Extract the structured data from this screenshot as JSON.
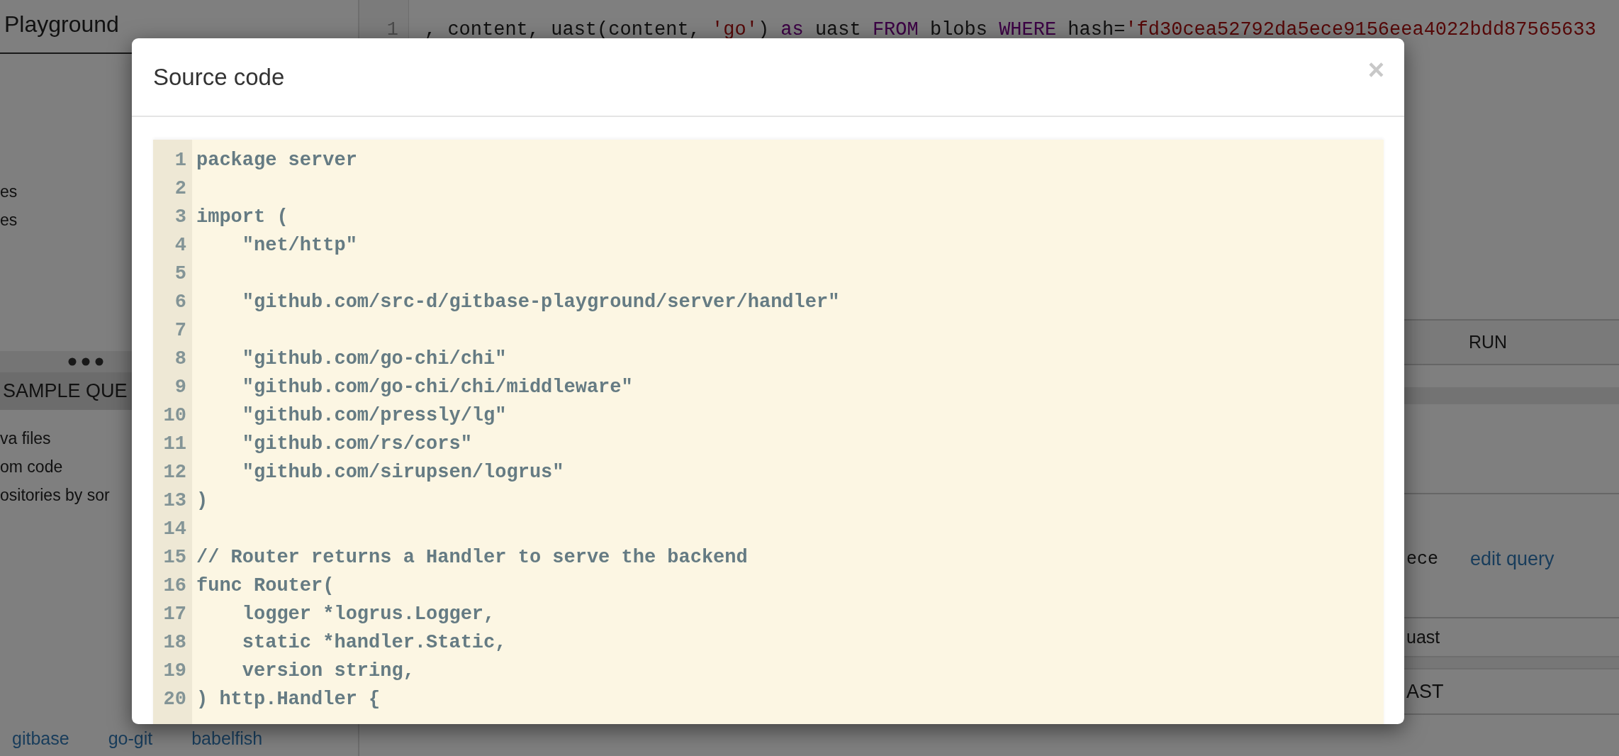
{
  "sidebar": {
    "title": "Playground",
    "items": [
      "es",
      "es"
    ],
    "sample_queries": {
      "header": "SAMPLE QUE",
      "items": [
        "va files",
        "om code",
        "ositories by sor"
      ]
    },
    "footer_links": [
      "gitbase",
      "go-git",
      "babelfish"
    ]
  },
  "editor": {
    "line_number": "1",
    "tokens": [
      {
        "kind": "plain",
        "text": ", content, uast(content, "
      },
      {
        "kind": "string",
        "text": "'go'"
      },
      {
        "kind": "plain",
        "text": ") "
      },
      {
        "kind": "keyword",
        "text": "as"
      },
      {
        "kind": "plain",
        "text": " uast "
      },
      {
        "kind": "keyword",
        "text": "FROM"
      },
      {
        "kind": "plain",
        "text": " blobs "
      },
      {
        "kind": "keyword",
        "text": "WHERE"
      },
      {
        "kind": "plain",
        "text": " hash="
      },
      {
        "kind": "string",
        "text": "'fd30cea52792da5ece9156eea4022bdd87565633"
      }
    ],
    "run_button": "RUN"
  },
  "results": {
    "hash_fragment": "ece",
    "edit_link": "edit query",
    "column_header": "uast",
    "ast_button": "AST"
  },
  "modal": {
    "title": "Source code",
    "close": "×",
    "lines": [
      {
        "number": "1",
        "code": "package server"
      },
      {
        "number": "2"
      },
      {
        "number": "3",
        "code": "import ("
      },
      {
        "number": "4",
        "code": "    \"net/http\""
      },
      {
        "number": "5"
      },
      {
        "number": "6",
        "code": "    \"github.com/src-d/gitbase-playground/server/handler\""
      },
      {
        "number": "7"
      },
      {
        "number": "8",
        "code": "    \"github.com/go-chi/chi\""
      },
      {
        "number": "9",
        "code": "    \"github.com/go-chi/chi/middleware\""
      },
      {
        "number": "10",
        "code": "    \"github.com/pressly/lg\""
      },
      {
        "number": "11",
        "code": "    \"github.com/rs/cors\""
      },
      {
        "number": "12",
        "code": "    \"github.com/sirupsen/logrus\""
      },
      {
        "number": "13",
        "code": ")"
      },
      {
        "number": "14"
      },
      {
        "number": "15",
        "code": "// Router returns a Handler to serve the backend"
      },
      {
        "number": "16",
        "code": "func Router("
      },
      {
        "number": "17",
        "code": "    logger *logrus.Logger,"
      },
      {
        "number": "18",
        "code": "    static *handler.Static,"
      },
      {
        "number": "19",
        "code": "    version string,"
      },
      {
        "number": "20",
        "code": ") http.Handler {"
      }
    ]
  }
}
